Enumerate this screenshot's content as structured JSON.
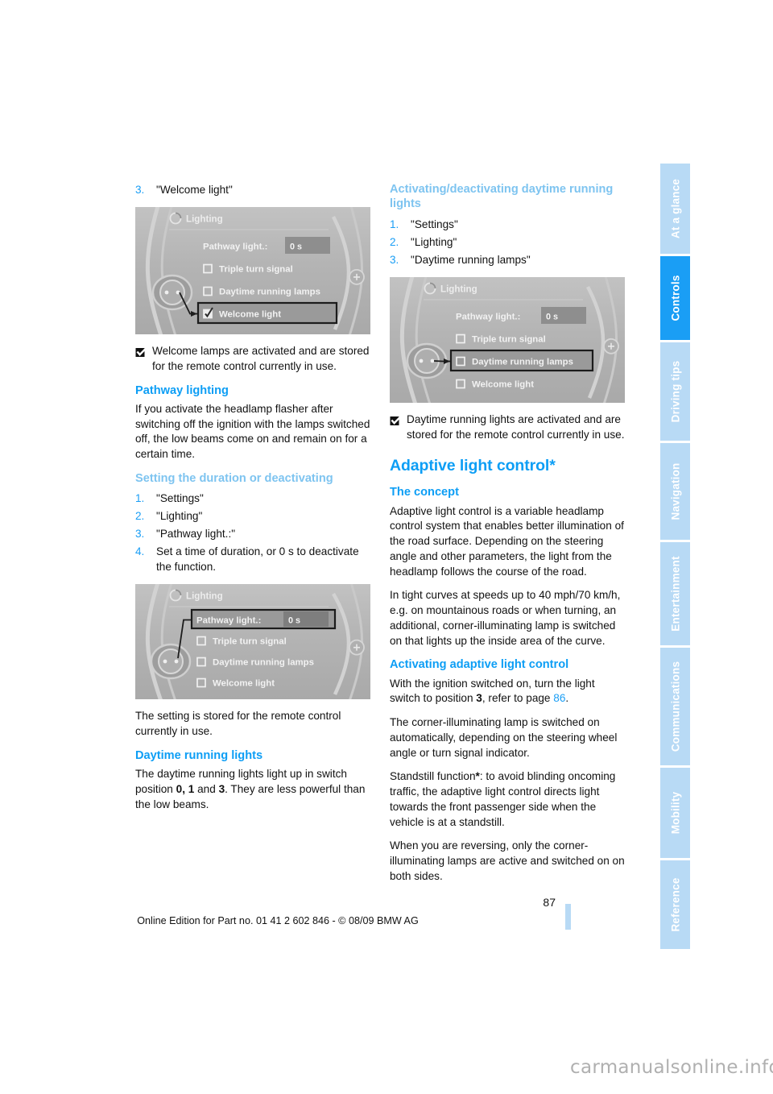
{
  "document": {
    "page_number": "87",
    "edition_line": "Online Edition for Part no. 01 41 2 602 846 - © 08/09 BMW AG",
    "watermark": "carmanualsonline.info"
  },
  "colors": {
    "accent_blue": "#0d9ef5",
    "light_blue": "#7ec4f0",
    "tab_inactive": "#b8daf5",
    "tab_active": "#1a9ef5",
    "screen_grey": "#b5b5b5"
  },
  "sidebar": {
    "tabs": [
      {
        "label": "At a glance",
        "active": false
      },
      {
        "label": "Controls",
        "active": true
      },
      {
        "label": "Driving tips",
        "active": false
      },
      {
        "label": "Navigation",
        "active": false
      },
      {
        "label": "Entertainment",
        "active": false
      },
      {
        "label": "Communications",
        "active": false
      },
      {
        "label": "Mobility",
        "active": false
      },
      {
        "label": "Reference",
        "active": false
      }
    ]
  },
  "left_column": {
    "step3": {
      "num": "3.",
      "text": "\"Welcome light\""
    },
    "screenshot1": {
      "title": "Lighting",
      "rows": [
        {
          "label": "Pathway light.:",
          "value": "0 s",
          "type": "value",
          "checked": false,
          "highlighted": false
        },
        {
          "label": "Triple turn signal",
          "type": "checkbox",
          "checked": false,
          "highlighted": false
        },
        {
          "label": "Daytime running lamps",
          "type": "checkbox",
          "checked": false,
          "highlighted": false
        },
        {
          "label": "Welcome light",
          "type": "checkbox",
          "checked": true,
          "highlighted": true
        }
      ]
    },
    "note1": "Welcome lamps are activated and are stored for the remote control currently in use.",
    "pathway_heading": "Pathway lighting",
    "pathway_body": "If you activate the headlamp flasher after switching off the ignition with the lamps switched off, the low beams come on and remain on for a certain time.",
    "setting_subheading": "Setting the duration or deactivating",
    "setting_steps": [
      {
        "num": "1.",
        "text": "\"Settings\""
      },
      {
        "num": "2.",
        "text": "\"Lighting\""
      },
      {
        "num": "3.",
        "text": "\"Pathway light.:\""
      },
      {
        "num": "4.",
        "text": "Set a time of duration, or 0 s to deactivate the function."
      }
    ],
    "screenshot2": {
      "title": "Lighting",
      "rows": [
        {
          "label": "Pathway light.:",
          "value": "0 s",
          "type": "value",
          "checked": false,
          "highlighted": true
        },
        {
          "label": "Triple turn signal",
          "type": "checkbox",
          "checked": false,
          "highlighted": false
        },
        {
          "label": "Daytime running lamps",
          "type": "checkbox",
          "checked": false,
          "highlighted": false
        },
        {
          "label": "Welcome light",
          "type": "checkbox",
          "checked": false,
          "highlighted": false
        }
      ]
    },
    "stored_note": "The setting is stored for the remote control currently in use.",
    "daytime_heading": "Daytime running lights",
    "daytime_body_1": "The daytime running lights light up in switch position ",
    "daytime_positions": "0, 1",
    "daytime_body_2": " and ",
    "daytime_position_3": "3",
    "daytime_body_3": ". They are less powerful than the low beams."
  },
  "right_column": {
    "activating_subheading": "Activating/deactivating daytime running lights",
    "activating_steps": [
      {
        "num": "1.",
        "text": "\"Settings\""
      },
      {
        "num": "2.",
        "text": "\"Lighting\""
      },
      {
        "num": "3.",
        "text": "\"Daytime running lamps\""
      }
    ],
    "screenshot3": {
      "title": "Lighting",
      "rows": [
        {
          "label": "Pathway light.:",
          "value": "0 s",
          "type": "value",
          "checked": false,
          "highlighted": false
        },
        {
          "label": "Triple turn signal",
          "type": "checkbox",
          "checked": false,
          "highlighted": false
        },
        {
          "label": "Daytime running lamps",
          "type": "checkbox",
          "checked": false,
          "highlighted": true
        },
        {
          "label": "Welcome light",
          "type": "checkbox",
          "checked": false,
          "highlighted": false
        }
      ]
    },
    "note2": "Daytime running lights are activated and are stored for the remote control currently in use.",
    "adaptive_heading": "Adaptive light control*",
    "concept_subheading": "The concept",
    "concept_body_1": "Adaptive light control is a variable headlamp control system that enables better illumination of the road surface. Depending on the steering angle and other parameters, the light from the headlamp follows the course of the road.",
    "concept_body_2": "In tight curves at speeds up to 40 mph/70 km/h, e.g. on mountainous roads or when turning, an additional, corner-illuminating lamp is switched on that lights up the inside area of the curve.",
    "activating_adaptive_heading": "Activating adaptive light control",
    "adaptive_body_1a": "With the ignition switched on, turn the light switch to position ",
    "adaptive_position": "3",
    "adaptive_body_1b": ", refer to page ",
    "adaptive_page_ref": "86",
    "adaptive_body_1c": ".",
    "adaptive_body_2": "The corner-illuminating lamp is switched on automatically, depending on the steering wheel angle or turn signal indicator.",
    "adaptive_body_3a": "Standstill function",
    "adaptive_body_3b": ": to avoid blinding oncoming traffic, the adaptive light control directs light towards the front passenger side when the vehicle is at a standstill.",
    "adaptive_body_4": "When you are reversing, only the corner-illuminating lamps are active and switched on on both sides."
  }
}
